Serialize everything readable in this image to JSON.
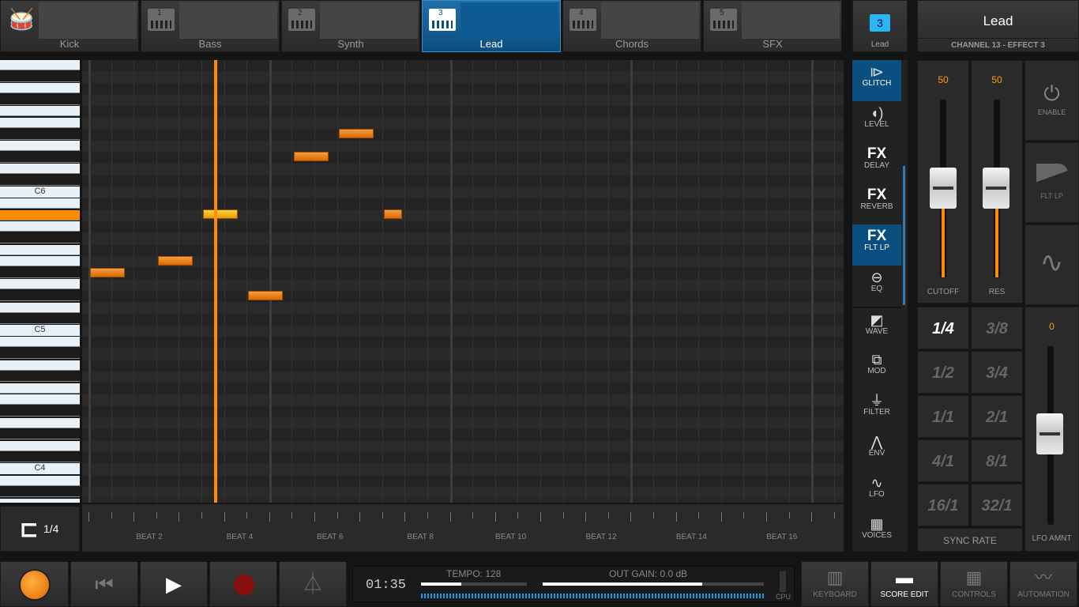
{
  "tracks": [
    {
      "name": "Kick",
      "num": ""
    },
    {
      "name": "Bass",
      "num": "1"
    },
    {
      "name": "Synth",
      "num": "2"
    },
    {
      "name": "Lead",
      "num": "3",
      "active": true
    },
    {
      "name": "Chords",
      "num": "4"
    },
    {
      "name": "SFX",
      "num": "5"
    }
  ],
  "channel": {
    "number": "3",
    "number_label": "Lead",
    "title": "Lead",
    "subtitle": "CHANNEL 13 - EFFECT 3"
  },
  "piano": {
    "labels": [
      "C6",
      "C5",
      "C4"
    ]
  },
  "quantize": {
    "value": "1/4"
  },
  "beats": [
    "BEAT 2",
    "BEAT 4",
    "BEAT 6",
    "BEAT 8",
    "BEAT 10",
    "BEAT 12",
    "BEAT 14",
    "BEAT 16"
  ],
  "effects": [
    {
      "label": "GLITCH",
      "icon": "glitch-icon",
      "glyph": "⧐",
      "selected": true
    },
    {
      "label": "LEVEL",
      "icon": "speaker-icon",
      "glyph": "◖)"
    },
    {
      "label": "DELAY",
      "icon": "fx-icon",
      "glyph": "FX"
    },
    {
      "label": "REVERB",
      "icon": "fx-icon",
      "glyph": "FX"
    },
    {
      "label": "FLT LP",
      "icon": "fx-icon",
      "glyph": "FX",
      "selected": true
    },
    {
      "label": "EQ",
      "icon": "eq-icon",
      "glyph": "⊖"
    },
    {
      "label": "WAVE",
      "icon": "wave-icon",
      "glyph": "◩"
    },
    {
      "label": "MOD",
      "icon": "mod-icon",
      "glyph": "⧉"
    },
    {
      "label": "FILTER",
      "icon": "filter-icon",
      "glyph": "⏚"
    },
    {
      "label": "ENV",
      "icon": "envelope-icon",
      "glyph": "⋀"
    },
    {
      "label": "LFO",
      "icon": "lfo-icon",
      "glyph": "∿"
    },
    {
      "label": "VOICES",
      "icon": "voices-icon",
      "glyph": "▦"
    }
  ],
  "faders": {
    "cutoff_value": "50",
    "cutoff_label": "CUTOFF",
    "res_value": "50",
    "res_label": "RES",
    "lfo_value": "0",
    "lfo_label": "LFO AMNT"
  },
  "side_buttons": {
    "enable": "ENABLE",
    "flt_lp": "FLT LP"
  },
  "sync_rate": {
    "label": "SYNC RATE",
    "options": [
      "1/4",
      "3/8",
      "1/2",
      "3/4",
      "1/1",
      "2/1",
      "4/1",
      "8/1",
      "16/1",
      "32/1"
    ],
    "selected": "1/4"
  },
  "transport": {
    "time": "01:35",
    "tempo": "TEMPO: 128",
    "out_gain": "OUT GAIN: 0.0 dB",
    "cpu": "CPU",
    "tempo_level": 0.38,
    "gain_level": 0.72
  },
  "views": [
    {
      "label": "KEYBOARD",
      "icon": "keyboard-icon",
      "glyph": "▥"
    },
    {
      "label": "SCORE EDIT",
      "icon": "score-edit-icon",
      "glyph": "▬",
      "selected": true
    },
    {
      "label": "CONTROLS",
      "icon": "controls-icon",
      "glyph": "▦"
    },
    {
      "label": "AUTOMATION",
      "icon": "automation-icon",
      "glyph": "〰"
    }
  ],
  "notes_pitch_rows": [
    {
      "beat": 0.0,
      "len": 0.75,
      "row": 0
    },
    {
      "beat": 0.75,
      "len": 0.75,
      "row": 1
    },
    {
      "beat": 1.25,
      "len": 0.75,
      "row": 2,
      "highlight": true
    },
    {
      "beat": 1.75,
      "len": 0.75,
      "row": -1
    },
    {
      "beat": 2.25,
      "len": 0.75,
      "row": 3
    },
    {
      "beat": 2.75,
      "len": 0.75,
      "row": 4
    },
    {
      "beat": 3.25,
      "len": 0.25,
      "row": 2
    }
  ],
  "colors": {
    "accent": "#ff8c00",
    "selected": "#0b4f80",
    "note": "#e06800"
  }
}
